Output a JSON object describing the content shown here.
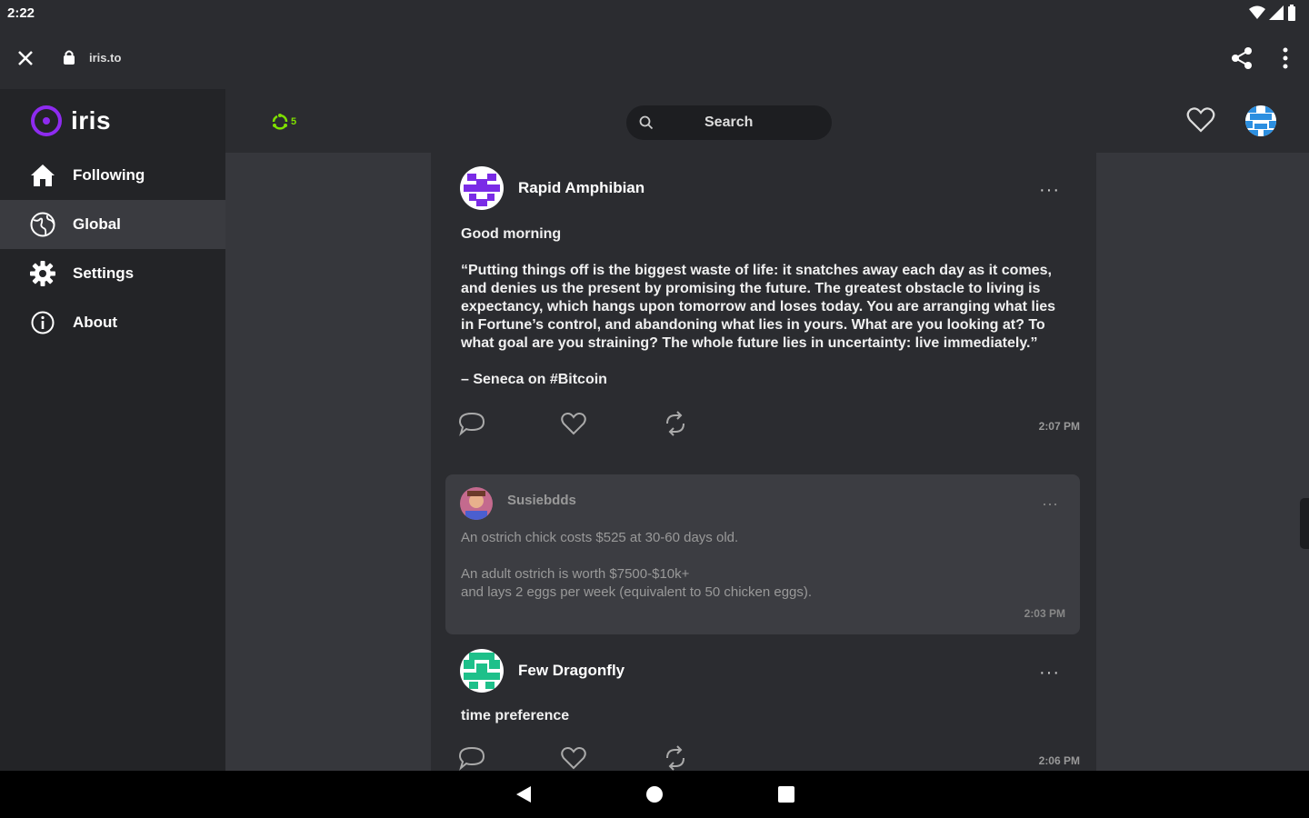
{
  "status_bar": {
    "time": "2:22"
  },
  "browser": {
    "url": "iris.to"
  },
  "sidebar": {
    "logo_text": "iris",
    "items": [
      {
        "label": "Following",
        "icon": "home-icon",
        "active": false
      },
      {
        "label": "Global",
        "icon": "globe-icon",
        "active": true
      },
      {
        "label": "Settings",
        "icon": "gear-icon",
        "active": false
      },
      {
        "label": "About",
        "icon": "info-icon",
        "active": false
      }
    ]
  },
  "topbar": {
    "relay_count": "5",
    "search_placeholder": "Search"
  },
  "posts": [
    {
      "author": "Rapid Amphibian",
      "text_lines": [
        "Good morning",
        "",
        "“Putting things off is the biggest waste of life: it snatches away each day as it comes,",
        "and denies us the present by promising the future. The greatest obstacle to living is",
        "expectancy, which hangs upon tomorrow and loses today. You are arranging what lies",
        "in Fortune’s control, and abandoning what lies in yours. What are you looking at? To",
        "what goal are you straining? The whole future lies in uncertainty: live immediately.”",
        "",
        "– Seneca on #Bitcoin"
      ],
      "time": "2:07 PM"
    },
    {
      "author": "Susiebdds",
      "text_lines": [
        "An ostrich chick costs $525 at 30-60 days old.",
        "",
        "An adult ostrich is worth $7500-$10k+",
        "and lays 2 eggs per week (equivalent to 50 chicken eggs)."
      ],
      "time": "2:03 PM"
    },
    {
      "author": "Few Dragonfly",
      "text_lines": [
        "time preference"
      ],
      "time": "2:06 PM"
    }
  ],
  "colors": {
    "accent": "#8e2bf0",
    "relay_green": "#7ee000",
    "background": "#2b2c30"
  }
}
